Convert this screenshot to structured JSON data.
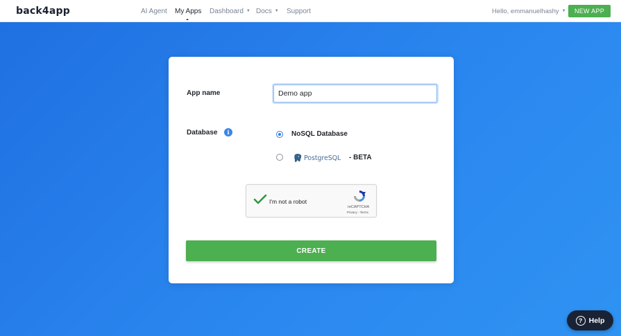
{
  "header": {
    "logo": "back4app",
    "nav": [
      {
        "label": "AI Agent",
        "dropdown": false,
        "active": false
      },
      {
        "label": "My Apps",
        "dropdown": false,
        "active": true
      },
      {
        "label": "Dashboard",
        "dropdown": true,
        "active": false
      },
      {
        "label": "Docs",
        "dropdown": true,
        "active": false
      },
      {
        "label": "Support",
        "dropdown": false,
        "active": false
      }
    ],
    "greeting": "Hello, emmanuelhashy",
    "new_app_label": "NEW APP"
  },
  "form": {
    "app_name_label": "App name",
    "app_name_value": "Demo app",
    "database_label": "Database",
    "info_icon": "i",
    "options": [
      {
        "label": "NoSQL Database",
        "selected": true
      },
      {
        "label": "PostgreSQL",
        "suffix": "- BETA",
        "selected": false
      }
    ],
    "recaptcha": {
      "text": "I'm not a robot",
      "brand": "reCAPTCHA",
      "links": "Privacy - Terms",
      "checked": true
    },
    "create_label": "CREATE"
  },
  "help": {
    "label": "Help",
    "icon": "?"
  },
  "colors": {
    "primary_green": "#4caf50",
    "accent_blue": "#2d7be5",
    "background_blue": "#2a86ef",
    "help_dark": "#1a2335"
  }
}
